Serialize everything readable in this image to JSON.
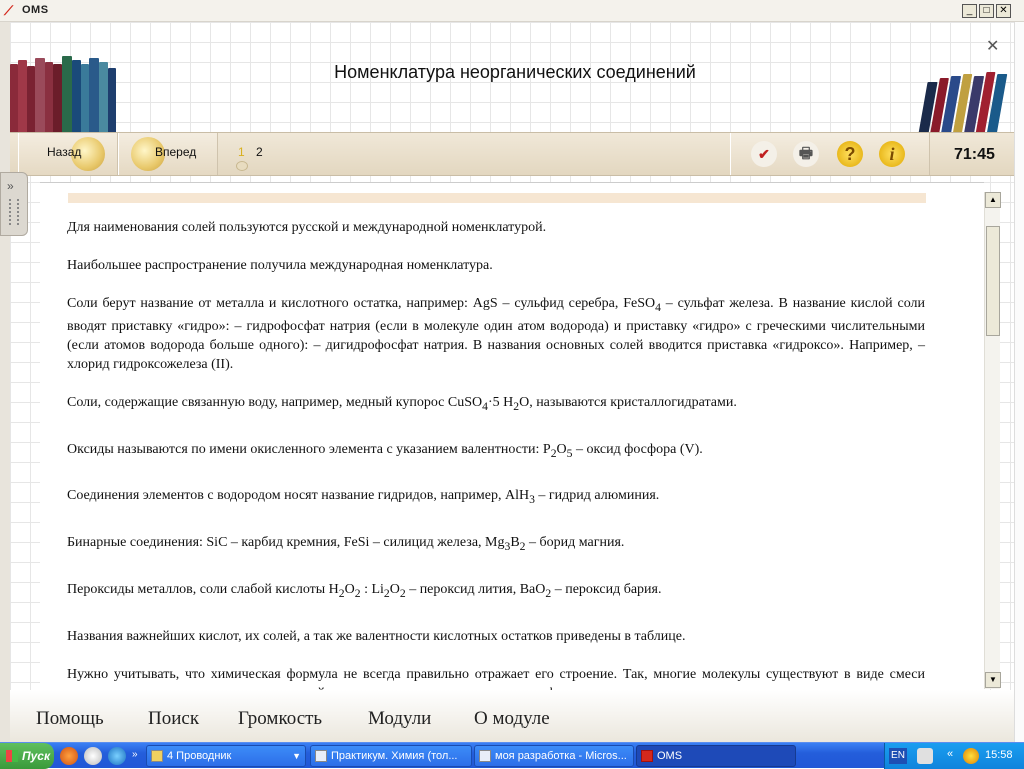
{
  "window": {
    "title": "OMS",
    "minimize": "_",
    "maximize": "□",
    "close": "✕",
    "inner_close": "✕"
  },
  "header": {
    "title": "Номенклатура неорганических соединений"
  },
  "toolbar": {
    "back_label": "Назад",
    "forward_label": "Вперед",
    "pages": [
      "1",
      "2"
    ],
    "current_page": "1",
    "icons": [
      "clipboard-check-icon",
      "print-icon",
      "help-icon",
      "info-icon"
    ],
    "timer": "71:45"
  },
  "content": {
    "p1": "Для наименования солей пользуются русской и международной номенклатурой.",
    "p2": "Наибольшее распространение получила международная номенклатура.",
    "p3": {
      "a": "Соли берут название от металла и кислотного остатка, например: AgS – сульфид серебра, FeSO",
      "s1": "4",
      "b": " – сульфат железа. В название кислой соли вводят приставку «гидро»: – гидрофосфат натрия (если в молекуле один атом водорода) и приставку «гидро» с греческими числительными (если атомов водорода больше одного): – дигидрофосфат натрия. В названия основных солей вводится приставка «гидроксо». Например, – хлорид гидроксожелеза (II)."
    },
    "p4": {
      "a": "Соли, содержащие связанную воду, например, медный купорос CuSO",
      "s1": "4",
      "b": "·5 H",
      "s2": "2",
      "c": "O, называются кристаллогидратами."
    },
    "p5": {
      "a": "Оксиды называются по имени окисленного элемента с указанием валентности: P",
      "s1": "2",
      "b": "O",
      "s2": "5",
      "c": " – оксид фосфора (V)."
    },
    "p6": {
      "a": "Соединения элементов с водородом носят название гидридов, например, AlH",
      "s1": "3",
      "b": " – гидрид алюминия."
    },
    "p7": {
      "a": "Бинарные соединения: SiC – карбид кремния, FeSi – силицид железа, Mg",
      "s1": "3",
      "b": "B",
      "s2": "2",
      "c": " – борид магния."
    },
    "p8": {
      "a": "Пероксиды металлов, соли слабой кислоты H",
      "s1": "2",
      "b": "O",
      "s2": "2",
      "c": " : Li",
      "s3": "2",
      "d": "O",
      "s4": "2",
      "e": " – пероксид лития, BaO",
      "s5": "2",
      "f": " – пероксид бария."
    },
    "p9": "Названия важнейших кислот, их солей, а так же валентности кислотных остатков приведены в таблице.",
    "p10": "Нужно учитывать, что химическая формула не всегда правильно отражает его строение. Так, многие молекулы существуют в виде смеси полимерных структур, их химические свойства различны и выделить одну модификацию из смеси практически"
  },
  "scrollbar": {
    "up": "▲",
    "down": "▼"
  },
  "bottom_menu": [
    "Помощь",
    "Поиск",
    "Громкость",
    "Модули",
    "О модуле"
  ],
  "taskbar": {
    "start": "Пуск",
    "tasks": [
      "4 Проводник",
      "Практикум. Химия (тол...",
      "моя разработка - Micros...",
      "OMS"
    ],
    "active_task": "OMS",
    "lang": "EN",
    "clock": "15:58"
  },
  "colors": {
    "accent": "#d4281c",
    "toolbar": "#e3d7c0",
    "taskbar": "#245edb"
  }
}
